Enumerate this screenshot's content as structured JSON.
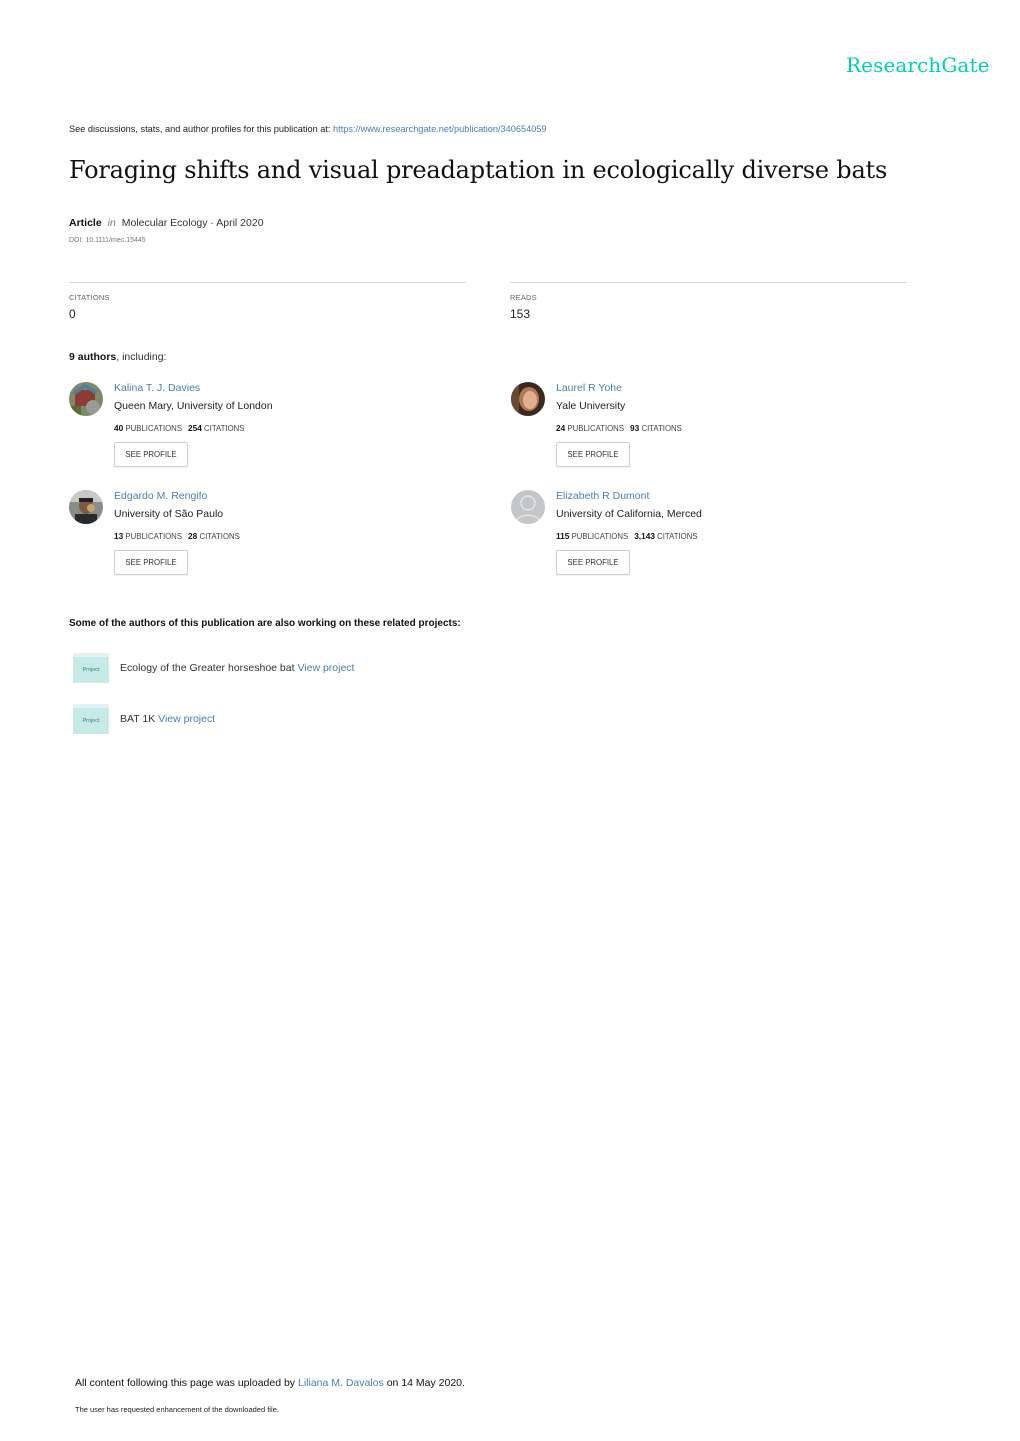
{
  "brand": {
    "logo_text": "ResearchGate",
    "accent_color": "#00d0af",
    "link_color": "#4a7eb0"
  },
  "header": {
    "see_text": "See discussions, stats, and author profiles for this publication at: ",
    "publication_url": "https://www.researchgate.net/publication/340654059"
  },
  "publication": {
    "title": "Foraging shifts and visual preadaptation in ecologically diverse bats",
    "type": "Article",
    "in_word": "in",
    "journal_date": "Molecular Ecology · April 2020",
    "doi": "DOI: 10.1111/mec.15445"
  },
  "stats": {
    "citations_label": "CITATIONS",
    "citations_value": "0",
    "reads_label": "READS",
    "reads_value": "153"
  },
  "authors_section": {
    "count_bold": "9 authors",
    "count_rest": ", including:"
  },
  "authors": [
    {
      "name": "Kalina T. J. Davies",
      "institution": "Queen Mary, University of London",
      "publications": "40",
      "publications_label": "PUBLICATIONS",
      "citations": "254",
      "citations_label": "CITATIONS",
      "button": "SEE PROFILE",
      "avatar": "photo"
    },
    {
      "name": "Laurel R Yohe",
      "institution": "Yale University",
      "publications": "24",
      "publications_label": "PUBLICATIONS",
      "citations": "93",
      "citations_label": "CITATIONS",
      "button": "SEE PROFILE",
      "avatar": "photo"
    },
    {
      "name": "Edgardo M. Rengifo",
      "institution": "University of São Paulo",
      "publications": "13",
      "publications_label": "PUBLICATIONS",
      "citations": "28",
      "citations_label": "CITATIONS",
      "button": "SEE PROFILE",
      "avatar": "photo"
    },
    {
      "name": "Elizabeth R Dumont",
      "institution": "University of California, Merced",
      "publications": "115",
      "publications_label": "PUBLICATIONS",
      "citations": "3,143",
      "citations_label": "CITATIONS",
      "button": "SEE PROFILE",
      "avatar": "placeholder-user-icon"
    }
  ],
  "related": {
    "heading": "Some of the authors of this publication are also working on these related projects:",
    "projects": [
      {
        "icon_label": "Project",
        "name": "Ecology of the Greater horseshoe bat",
        "link": "View project"
      },
      {
        "icon_label": "Project",
        "name": "BAT 1K",
        "link": "View project"
      }
    ]
  },
  "footer": {
    "upload_prefix": "All content following this page was uploaded by ",
    "uploader": "Liliana M. Davalos",
    "upload_suffix": " on 14 May 2020.",
    "note": "The user has requested enhancement of the downloaded file."
  }
}
